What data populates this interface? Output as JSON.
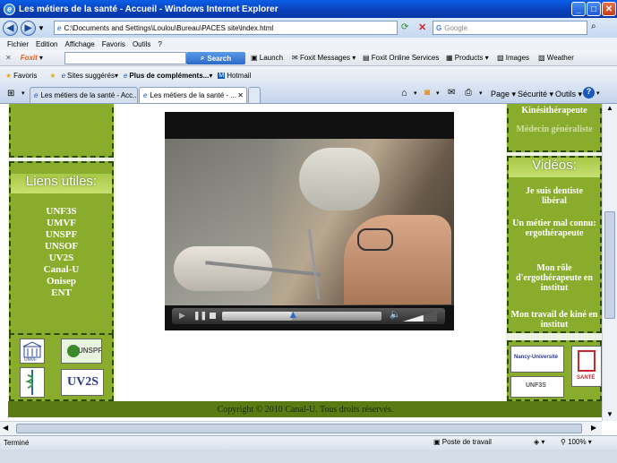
{
  "window": {
    "title": "Les métiers de la santé - Accueil - Windows Internet Explorer"
  },
  "address": {
    "url": "C:\\Documents and Settings\\Loulou\\Bureau\\PACES site\\index.html",
    "search_placeholder": "Google"
  },
  "menu": [
    "Fichier",
    "Edition",
    "Affichage",
    "Favoris",
    "Outils",
    "?"
  ],
  "foxit": {
    "brand": "Foxit",
    "search_label": "Search",
    "items": [
      "Launch",
      "Foxit Messages",
      "Foxit Online Services",
      "Products",
      "Images",
      "Weather"
    ]
  },
  "favorites": {
    "label": "Favoris",
    "items": [
      "Sites suggérés",
      "Plus de compléments...",
      "Hotmail"
    ]
  },
  "tabs": [
    {
      "label": "Les métiers de la santé - Acc..."
    },
    {
      "label": "Les métiers de la santé - ..."
    }
  ],
  "toolbar_right": [
    "Page",
    "Sécurité",
    "Outils"
  ],
  "left": {
    "liens_title": "Liens utiles:",
    "links": [
      "UNF3S",
      "UMVF",
      "UNSPF",
      "UNSOF",
      "UV2S",
      "Canal-U",
      "Onisep",
      "ENT"
    ],
    "logos": [
      "UMVF",
      "UNSPF",
      "",
      "UV2S"
    ]
  },
  "right": {
    "top_links": [
      "Kinésithérapeute",
      "Médecin généraliste"
    ],
    "videos_title": "Vidéos:",
    "videos": [
      "Je suis dentiste libéral",
      "Un métier mal connu: ergothérapeute",
      "Mon rôle d'ergothérapeute en institut",
      "Mon travail de kiné en institut"
    ],
    "logos": [
      "Nancy-Université",
      "SANTÉ",
      "UNF3S"
    ]
  },
  "video": {
    "progress": 0.44,
    "volume": 0.6
  },
  "footer": {
    "copyright": "Copyright © 2010 Canal-U. Tous droits réservés."
  },
  "status": {
    "left": "Terminé",
    "zone": "Poste de travail",
    "zoom": "100%"
  }
}
